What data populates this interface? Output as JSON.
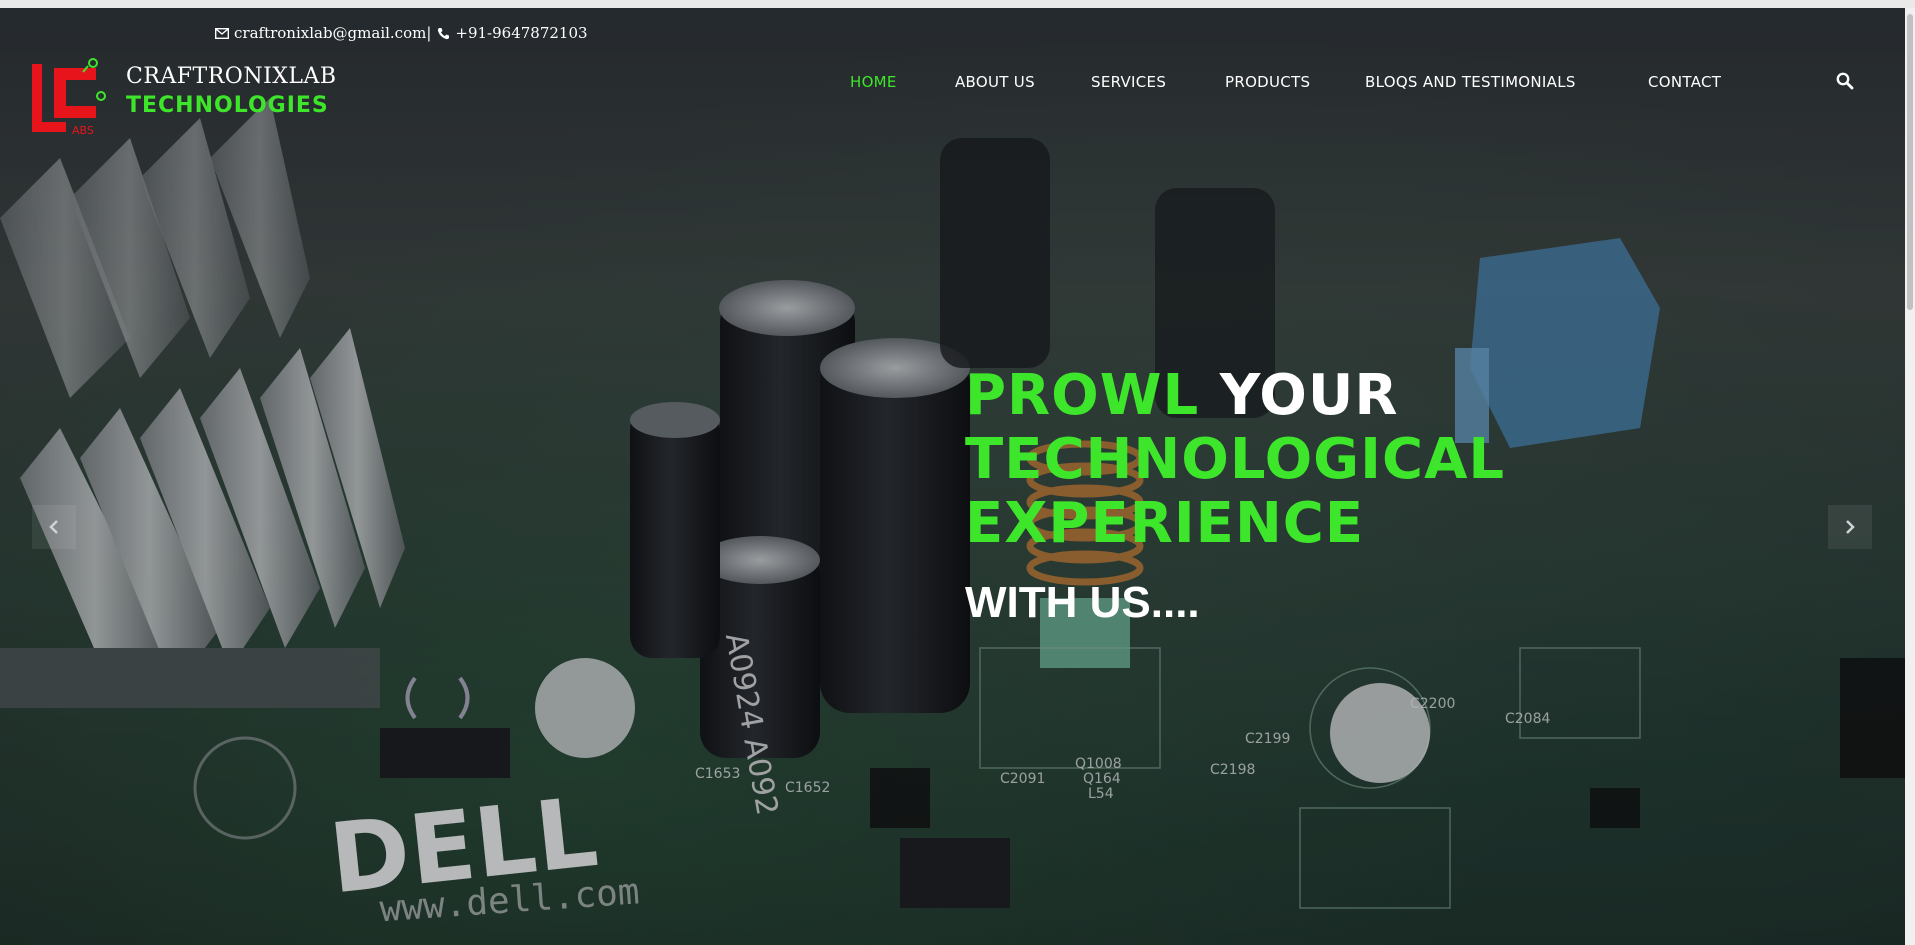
{
  "header": {
    "email": "craftronixlab@gmail.com|",
    "phone": "+91-9647872103",
    "brand_line1": "CRAFTRONIXLAB",
    "brand_line2": "TECHNOLOGIES",
    "logo_text": "ABS"
  },
  "nav": {
    "items": [
      {
        "label": "HOME",
        "active": true
      },
      {
        "label": "ABOUT US",
        "active": false
      },
      {
        "label": "SERVICES",
        "active": false
      },
      {
        "label": "PRODUCTS",
        "active": false
      },
      {
        "label": "BLOQS AND TESTIMONIALS",
        "active": false
      },
      {
        "label": "CONTACT",
        "active": false
      }
    ]
  },
  "hero": {
    "headline_green1": "PROWL",
    "headline_white1": "YOUR",
    "headline_green2": "TECHNOLOGICAL",
    "headline_green3": "EXPERIENCE",
    "subline": "WITH US....",
    "board_brand": "DELL",
    "board_url": "www.dell.com",
    "capacitor_text": "A0924 A092",
    "labels": [
      "C1652",
      "C1653",
      "C2091",
      "Q1008",
      "Q164",
      "L54",
      "C2200",
      "C2198",
      "C2199",
      "C2084"
    ]
  },
  "colors": {
    "accent": "#3ee62b",
    "logo_red": "#e8141c"
  },
  "icons": [
    "envelope-icon",
    "phone-icon",
    "search-icon",
    "chevron-left-icon",
    "chevron-right-icon"
  ]
}
